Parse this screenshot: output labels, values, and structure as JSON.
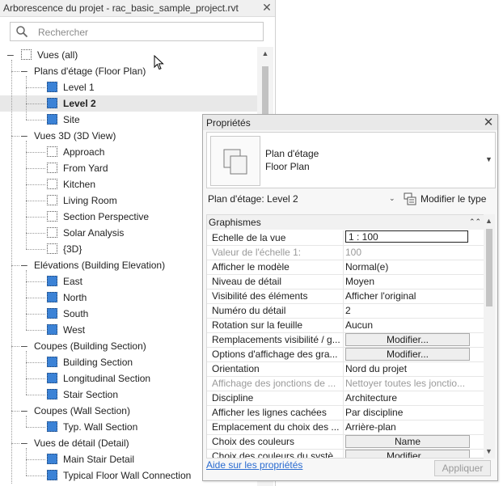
{
  "browser": {
    "title": "Arborescence du projet - rac_basic_sample_project.rvt",
    "close_label": "✕",
    "search_placeholder": "Rechercher",
    "tree": {
      "root_label": "Vues (all)",
      "groups": [
        {
          "label": "Plans d'étage (Floor Plan)",
          "items": [
            {
              "label": "Level 1",
              "icon": "floor-plan-icon"
            },
            {
              "label": "Level 2",
              "icon": "floor-plan-icon",
              "selected": true
            },
            {
              "label": "Site",
              "icon": "floor-plan-icon"
            }
          ]
        },
        {
          "label": "Vues 3D (3D View)",
          "items": [
            {
              "label": "Approach",
              "icon": "3d-view-icon"
            },
            {
              "label": "From Yard",
              "icon": "3d-view-icon"
            },
            {
              "label": "Kitchen",
              "icon": "3d-view-icon"
            },
            {
              "label": "Living Room",
              "icon": "3d-view-icon"
            },
            {
              "label": "Section Perspective",
              "icon": "3d-view-icon"
            },
            {
              "label": "Solar Analysis",
              "icon": "3d-view-icon"
            },
            {
              "label": "{3D}",
              "icon": "3d-view-icon"
            }
          ]
        },
        {
          "label": "Elévations (Building Elevation)",
          "items": [
            {
              "label": "East",
              "icon": "elevation-icon"
            },
            {
              "label": "North",
              "icon": "elevation-icon"
            },
            {
              "label": "South",
              "icon": "elevation-icon"
            },
            {
              "label": "West",
              "icon": "elevation-icon"
            }
          ]
        },
        {
          "label": "Coupes (Building Section)",
          "items": [
            {
              "label": "Building Section",
              "icon": "section-icon"
            },
            {
              "label": "Longitudinal Section",
              "icon": "section-icon"
            },
            {
              "label": "Stair Section",
              "icon": "section-icon"
            }
          ]
        },
        {
          "label": "Coupes (Wall Section)",
          "items": [
            {
              "label": "Typ. Wall Section",
              "icon": "section-icon"
            }
          ]
        },
        {
          "label": "Vues de détail (Detail)",
          "items": [
            {
              "label": "Main Stair Detail",
              "icon": "detail-icon"
            },
            {
              "label": "Typical Floor Wall Connection",
              "icon": "detail-icon"
            }
          ]
        }
      ]
    }
  },
  "properties": {
    "title": "Propriétés",
    "close_label": "✕",
    "type_name_line1": "Plan d'étage",
    "type_name_line2": "Floor Plan",
    "instance_filter": "Plan d'étage: Level 2",
    "edit_type_label": "Modifier le type",
    "section_label": "Graphismes",
    "rows": [
      {
        "label": "Echelle de la vue",
        "value": "1 : 100",
        "kind": "input"
      },
      {
        "label": "Valeur de l'échelle    1:",
        "value": "100",
        "kind": "disabled"
      },
      {
        "label": "Afficher le modèle",
        "value": "Normal(e)",
        "kind": "text"
      },
      {
        "label": "Niveau de détail",
        "value": "Moyen",
        "kind": "text"
      },
      {
        "label": "Visibilité des éléments",
        "value": "Afficher l'original",
        "kind": "text"
      },
      {
        "label": "Numéro du détail",
        "value": "2",
        "kind": "text"
      },
      {
        "label": "Rotation sur la feuille",
        "value": "Aucun",
        "kind": "text"
      },
      {
        "label": "Remplacements visibilité / g...",
        "value": "Modifier...",
        "kind": "button"
      },
      {
        "label": "Options d'affichage des gra...",
        "value": "Modifier...",
        "kind": "button"
      },
      {
        "label": "Orientation",
        "value": "Nord du projet",
        "kind": "text"
      },
      {
        "label": "Affichage des jonctions de ...",
        "value": "Nettoyer toutes les jonctio...",
        "kind": "disabled"
      },
      {
        "label": "Discipline",
        "value": "Architecture",
        "kind": "text"
      },
      {
        "label": "Afficher les lignes cachées",
        "value": "Par discipline",
        "kind": "text"
      },
      {
        "label": "Emplacement du choix des ...",
        "value": "Arrière-plan",
        "kind": "text"
      },
      {
        "label": "Choix des couleurs",
        "value": "Name",
        "kind": "button"
      },
      {
        "label": "Choix des couleurs du systè...",
        "value": "Modifier...",
        "kind": "button"
      }
    ],
    "help_link": "Aide sur les propriétés",
    "apply_label": "Appliquer"
  },
  "colors": {
    "view_icon_blue": "#3b82d6",
    "link": "#2a6bd0",
    "selection": "#e8e8e8"
  }
}
